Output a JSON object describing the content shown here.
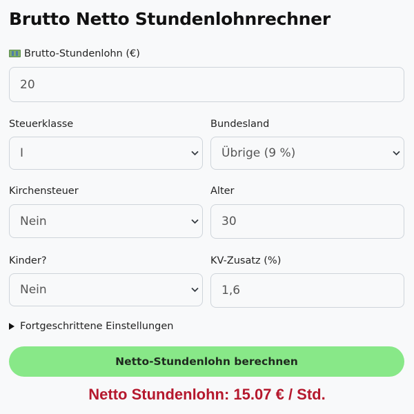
{
  "title": "Brutto Netto Stundenlohnrechner",
  "icons": {
    "money": "banknote-icon",
    "select": "chevron-down-icon",
    "details": "disclosure-triangle-icon"
  },
  "fields": {
    "hourly_wage": {
      "label": "Brutto-Stundenlohn (€)",
      "value": "20"
    },
    "tax_class": {
      "label": "Steuerklasse",
      "value": "I"
    },
    "state": {
      "label": "Bundesland",
      "value": "Übrige (9 %)"
    },
    "church_tax": {
      "label": "Kirchensteuer",
      "value": "Nein"
    },
    "age": {
      "label": "Alter",
      "value": "30"
    },
    "children": {
      "label": "Kinder?",
      "value": "Nein"
    },
    "kv_extra": {
      "label": "KV-Zusatz (%)",
      "value": "1,6"
    }
  },
  "advanced": {
    "label": "Fortgeschrittene Einstellungen"
  },
  "button": {
    "label": "Netto-Stundenlohn berechnen"
  },
  "result": {
    "text": "Netto Stundenlohn: 15.07 € / Std."
  },
  "colors": {
    "button_bg": "#88e888",
    "result_text": "#b5182d",
    "border": "#ced4da"
  }
}
